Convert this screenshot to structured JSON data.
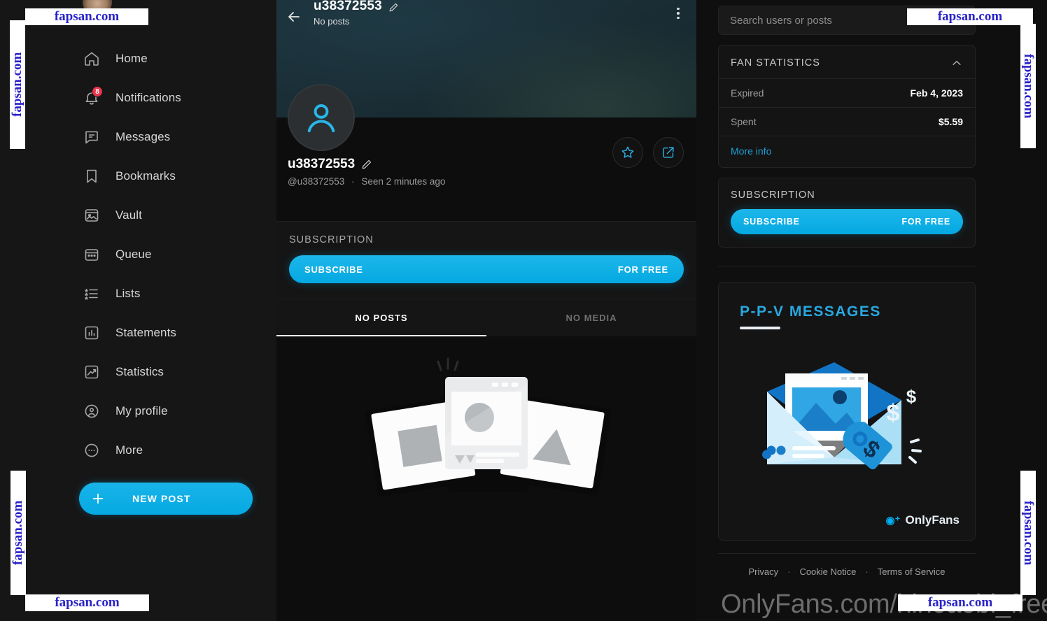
{
  "sidebar": {
    "items": [
      {
        "label": "Home",
        "icon": "home-icon"
      },
      {
        "label": "Notifications",
        "icon": "bell-icon",
        "badge": "8"
      },
      {
        "label": "Messages",
        "icon": "chat-bubble-icon"
      },
      {
        "label": "Bookmarks",
        "icon": "bookmark-icon"
      },
      {
        "label": "Vault",
        "icon": "vault-image-icon"
      },
      {
        "label": "Queue",
        "icon": "calendar-icon"
      },
      {
        "label": "Lists",
        "icon": "list-icon"
      },
      {
        "label": "Statements",
        "icon": "bar-chart-icon"
      },
      {
        "label": "Statistics",
        "icon": "trend-chart-icon"
      },
      {
        "label": "My profile",
        "icon": "person-circle-icon"
      },
      {
        "label": "More",
        "icon": "ellipsis-circle-icon"
      }
    ],
    "new_post_label": "NEW POST"
  },
  "center": {
    "header": {
      "title": "u38372553",
      "subtitle": "No posts",
      "back_icon": "arrow-left-icon",
      "edit_icon": "pencil-icon",
      "menu_icon": "kebab-menu-icon"
    },
    "profile": {
      "display_name": "u38372553",
      "handle": "@u38372553",
      "separator": "·",
      "seen": "Seen 2 minutes ago",
      "avatar_icon": "default-user-avatar-icon",
      "favorite_icon": "star-icon",
      "share_icon": "share-icon"
    },
    "subscription": {
      "heading": "SUBSCRIPTION",
      "button_label": "SUBSCRIBE",
      "button_price": "FOR FREE"
    },
    "tabs": [
      {
        "label": "NO POSTS",
        "active": true
      },
      {
        "label": "NO MEDIA",
        "active": false
      }
    ]
  },
  "right": {
    "search": {
      "placeholder": "Search users or posts",
      "value": ""
    },
    "fan_statistics": {
      "heading": "FAN STATISTICS",
      "collapse_icon": "chevron-up-icon",
      "rows": [
        {
          "key": "Expired",
          "value": "Feb 4, 2023"
        },
        {
          "key": "Spent",
          "value": "$5.59"
        }
      ],
      "more_info": "More info"
    },
    "subscription": {
      "heading": "SUBSCRIPTION",
      "button_label": "SUBSCRIBE",
      "button_price": "FOR FREE"
    },
    "promo": {
      "title": "P-P-V  MESSAGES",
      "brand": "OnlyFans",
      "brand_mark": "of-logo-icon"
    },
    "footer": {
      "links": [
        "Privacy",
        "Cookie Notice",
        "Terms of Service"
      ],
      "separator": "·"
    }
  },
  "watermark": {
    "text": "fapsan.com",
    "page_url": "OnlyFans.com/hinoaobi_free"
  },
  "colors": {
    "accent_blue": "#06a9e2",
    "badge_red": "#e8334a",
    "link_blue": "#1d9fd8",
    "promo_title": "#29a8e0",
    "watermark_blue": "#2a23c8",
    "cover_teal": "#1b2f38"
  }
}
